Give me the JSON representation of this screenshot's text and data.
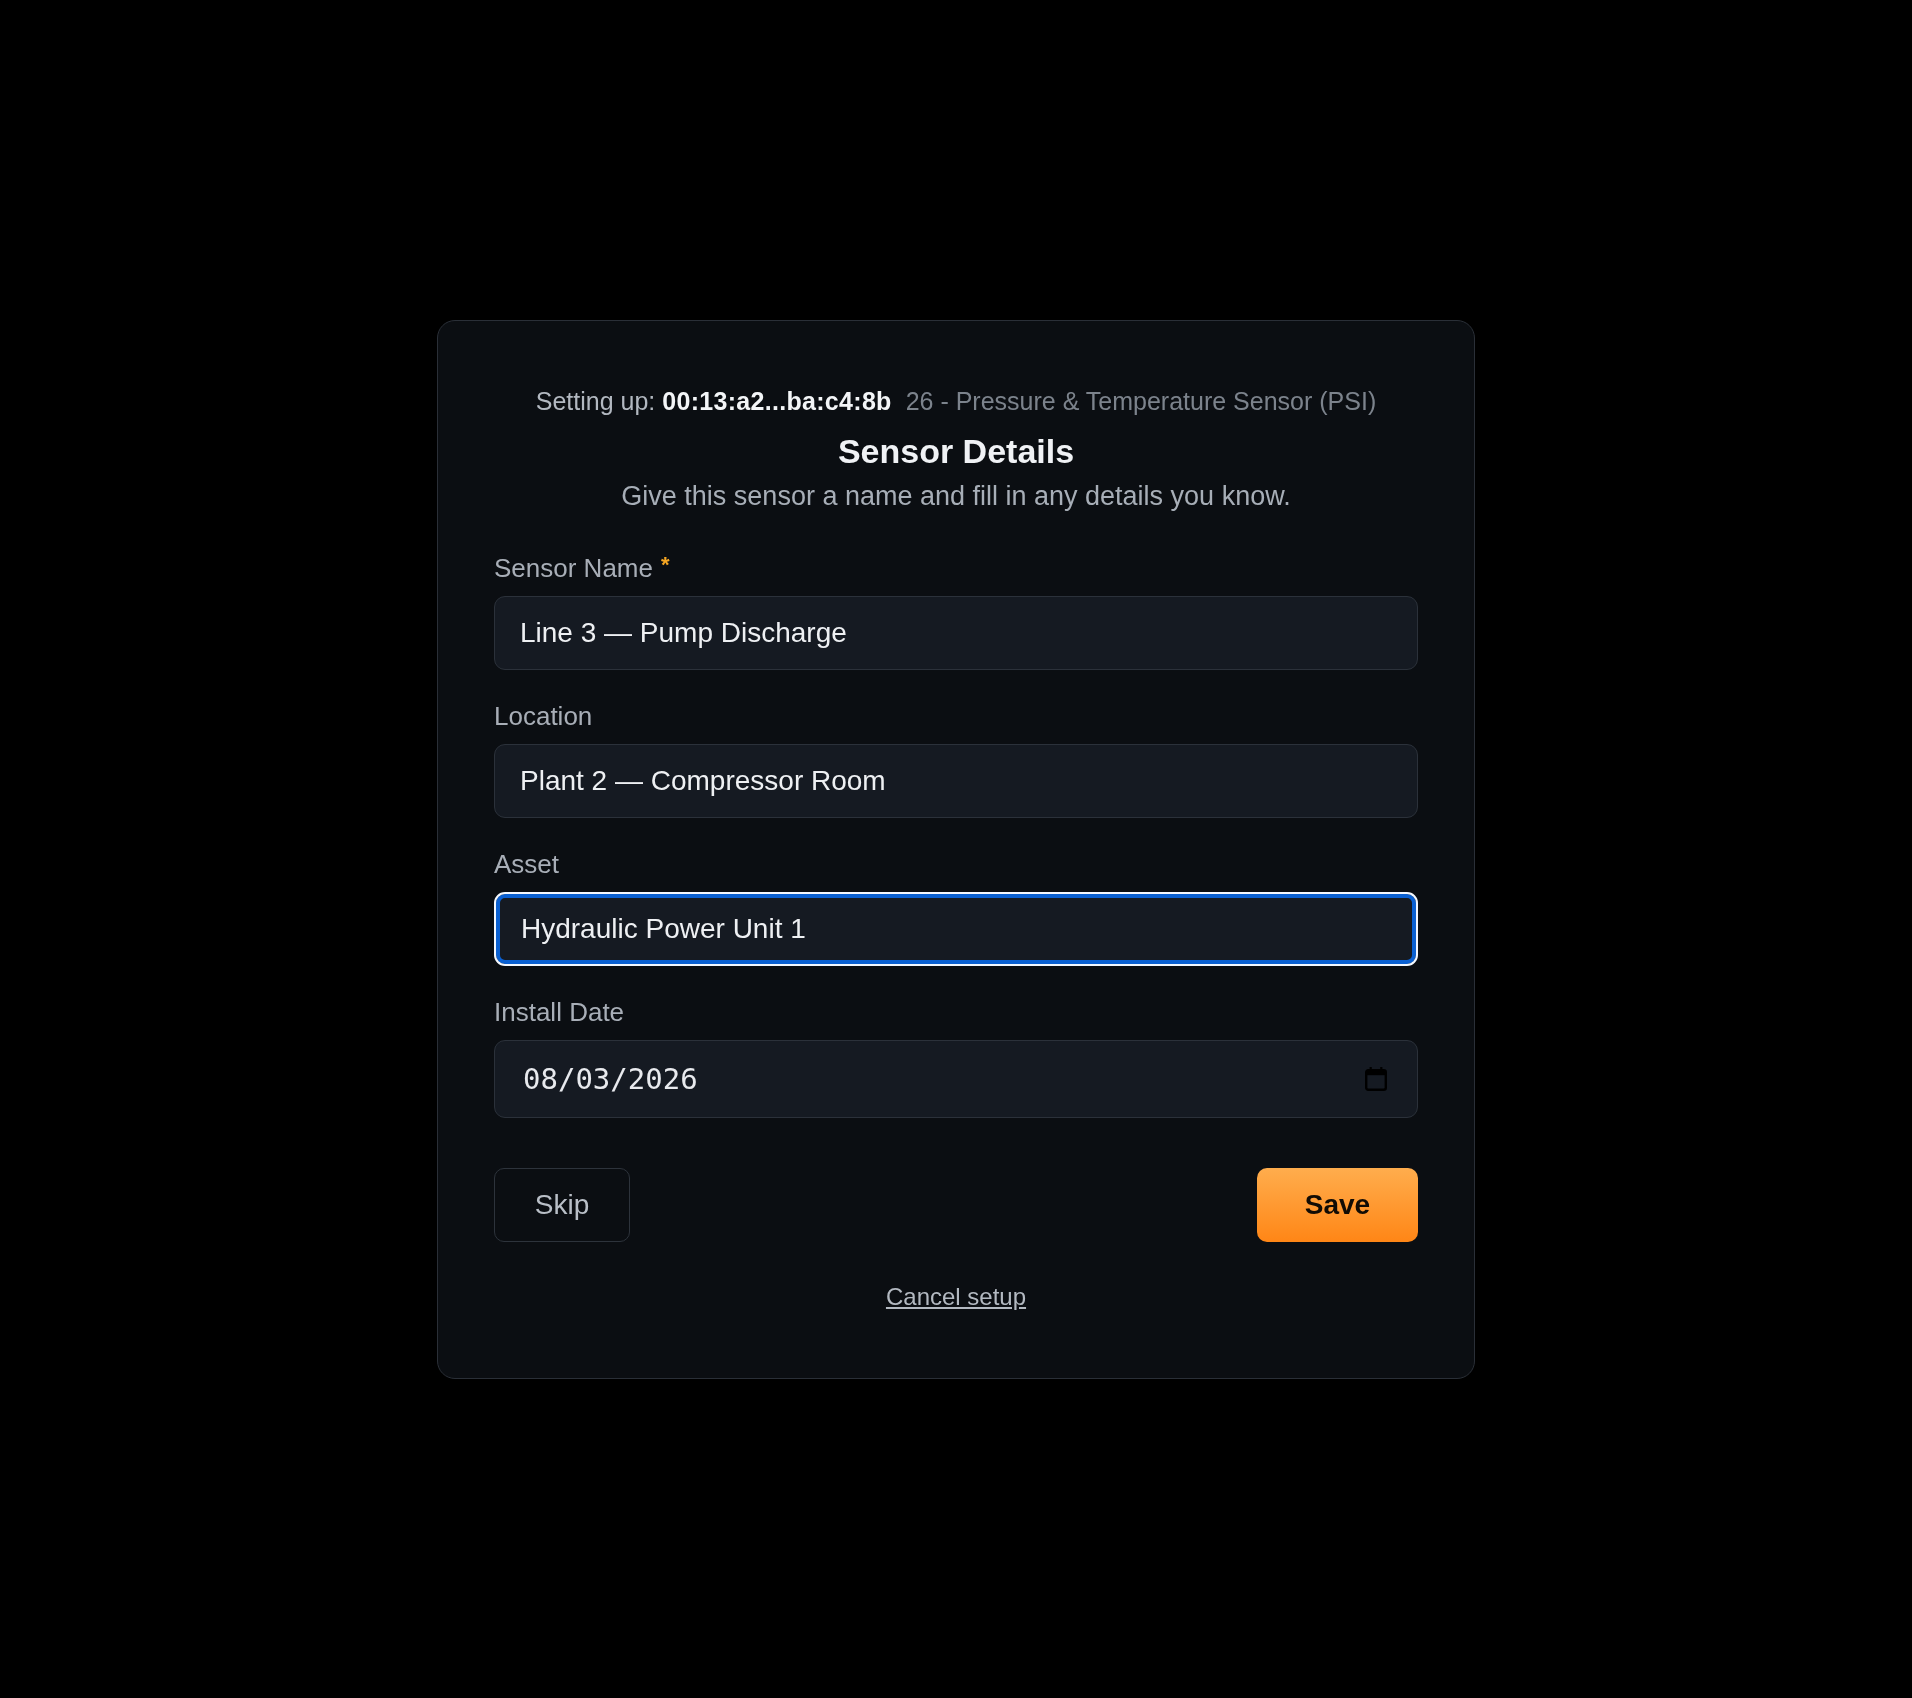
{
  "header": {
    "setup_text": "Setting up: **00:13:a2...ba:c4:8b**",
    "device_type": "26 - Pressure & Temperature Sensor (PSI)"
  },
  "title": "Sensor Details",
  "subtitle": "Give this sensor a name and fill in any details you know.",
  "required_marker": "*",
  "fields": [
    {
      "kind": "text",
      "label": "Sensor Name",
      "required": true,
      "value": "Line 3 — Pump Discharge",
      "focused": false
    },
    {
      "kind": "text",
      "label": "Location",
      "required": false,
      "value": "Plant 2 — Compressor Room",
      "focused": false
    },
    {
      "kind": "text",
      "label": "Asset",
      "required": false,
      "value": "Hydraulic Power Unit 1",
      "focused": true
    },
    {
      "kind": "date",
      "label": "Install Date",
      "required": false,
      "value": "08/03/2026",
      "focused": false
    }
  ],
  "actions": [
    {
      "kind": "secondary",
      "label": "Skip"
    },
    {
      "kind": "primary",
      "label": "Save"
    }
  ],
  "cancel_link": "Cancel setup"
}
